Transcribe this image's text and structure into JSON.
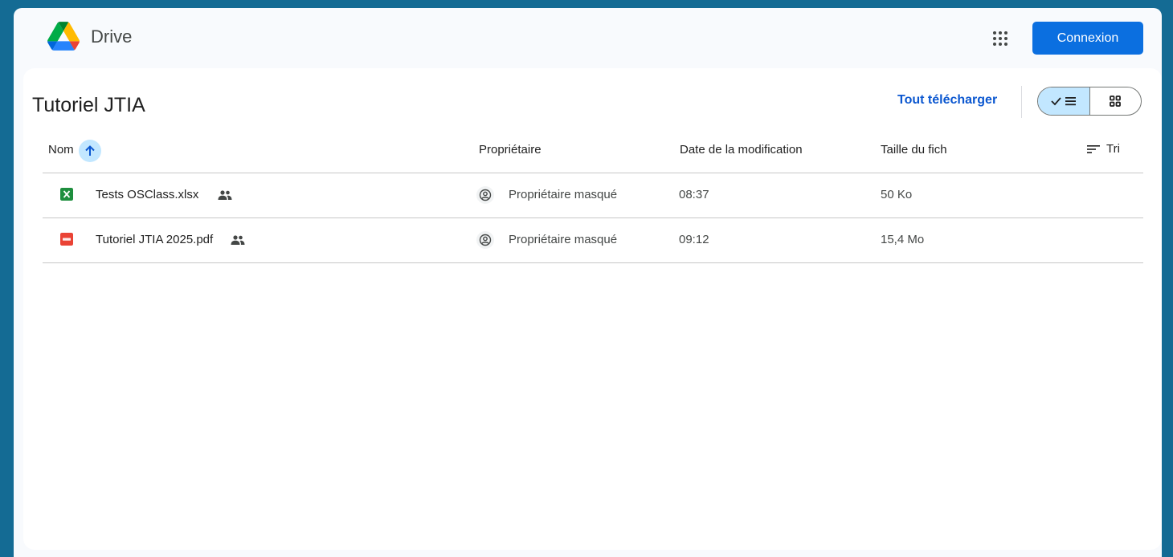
{
  "app": {
    "name": "Drive",
    "signin_label": "Connexion"
  },
  "folder": {
    "title": "Tutoriel JTIA",
    "download_all": "Tout télécharger"
  },
  "view_toggle": {
    "active": "list"
  },
  "columns": {
    "name": "Nom",
    "owner": "Propriétaire",
    "modified": "Date de la modification",
    "size": "Taille du fich",
    "sort": "Tri"
  },
  "files": [
    {
      "name": "Tests OSClass.xlsx",
      "type": "xlsx",
      "shared": true,
      "owner": "Propriétaire masqué",
      "modified": "08:37",
      "size": "50 Ko"
    },
    {
      "name": "Tutoriel JTIA 2025.pdf",
      "type": "pdf",
      "shared": true,
      "owner": "Propriétaire masqué",
      "modified": "09:12",
      "size": "15,4 Mo"
    }
  ],
  "colors": {
    "background": "#146b94",
    "accent": "#0b57d0",
    "button": "#0b6fe0",
    "selected": "#c2e7ff"
  }
}
